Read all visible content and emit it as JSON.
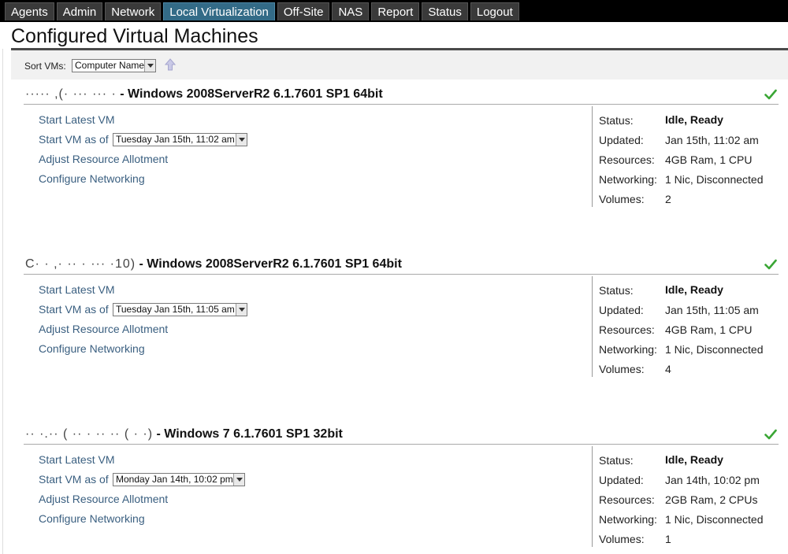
{
  "nav": {
    "tabs": [
      {
        "label": "Agents",
        "active": false
      },
      {
        "label": "Admin",
        "active": false
      },
      {
        "label": "Network",
        "active": false
      },
      {
        "label": "Local Virtualization",
        "active": true
      },
      {
        "label": "Off-Site",
        "active": false
      },
      {
        "label": "NAS",
        "active": false
      },
      {
        "label": "Report",
        "active": false
      },
      {
        "label": "Status",
        "active": false
      },
      {
        "label": "Logout",
        "active": false
      }
    ]
  },
  "page": {
    "title": "Configured Virtual Machines"
  },
  "toolbar": {
    "sort_label": "Sort VMs:",
    "sort_value": "Computer Name",
    "sort_direction_icon": "up-arrow-icon"
  },
  "vms": [
    {
      "name_prefix": "·····  ,(·  ···  ··· ·",
      "os": "- Windows 2008ServerR2 6.1.7601 SP1 64bit",
      "actions": {
        "start_latest": "Start Latest VM",
        "start_as_of": "Start VM as of",
        "snapshot": "Tuesday Jan 15th, 11:02 am",
        "adjust": "Adjust Resource Allotment",
        "networking": "Configure Networking"
      },
      "info": {
        "status_label": "Status:",
        "status": "Idle, Ready",
        "updated_label": "Updated:",
        "updated": "Jan 15th, 11:02 am",
        "resources_label": "Resources:",
        "resources": "4GB Ram, 1 CPU",
        "networking_label": "Networking:",
        "networking": "1 Nic, Disconnected",
        "volumes_label": "Volumes:",
        "volumes": "2"
      }
    },
    {
      "name_prefix": "C·  ·  ,·  ··  ·  ···  ·10)",
      "os": "- Windows 2008ServerR2 6.1.7601 SP1 64bit",
      "actions": {
        "start_latest": "Start Latest VM",
        "start_as_of": "Start VM as of",
        "snapshot": "Tuesday Jan 15th, 11:05 am",
        "adjust": "Adjust Resource Allotment",
        "networking": "Configure Networking"
      },
      "info": {
        "status_label": "Status:",
        "status": "Idle, Ready",
        "updated_label": "Updated:",
        "updated": "Jan 15th, 11:05 am",
        "resources_label": "Resources:",
        "resources": "4GB Ram, 1 CPU",
        "networking_label": "Networking:",
        "networking": "1 Nic, Disconnected",
        "volumes_label": "Volumes:",
        "volumes": "4"
      }
    },
    {
      "name_prefix": "·· ·.·· ( ··  ·  ··  ·· ( ·  ·)",
      "os": "- Windows 7 6.1.7601 SP1 32bit",
      "actions": {
        "start_latest": "Start Latest VM",
        "start_as_of": "Start VM as of",
        "snapshot": "Monday Jan 14th, 10:02 pm",
        "adjust": "Adjust Resource Allotment",
        "networking": "Configure Networking"
      },
      "info": {
        "status_label": "Status:",
        "status": "Idle, Ready",
        "updated_label": "Updated:",
        "updated": "Jan 14th, 10:02 pm",
        "resources_label": "Resources:",
        "resources": "2GB Ram, 2 CPUs",
        "networking_label": "Networking:",
        "networking": "1 Nic, Disconnected",
        "volumes_label": "Volumes:",
        "volumes": "1"
      }
    }
  ],
  "colors": {
    "nav_bg": "#3a3a3a",
    "nav_active": "#336b87",
    "link": "#3a5f80",
    "check": "#3aa635"
  }
}
